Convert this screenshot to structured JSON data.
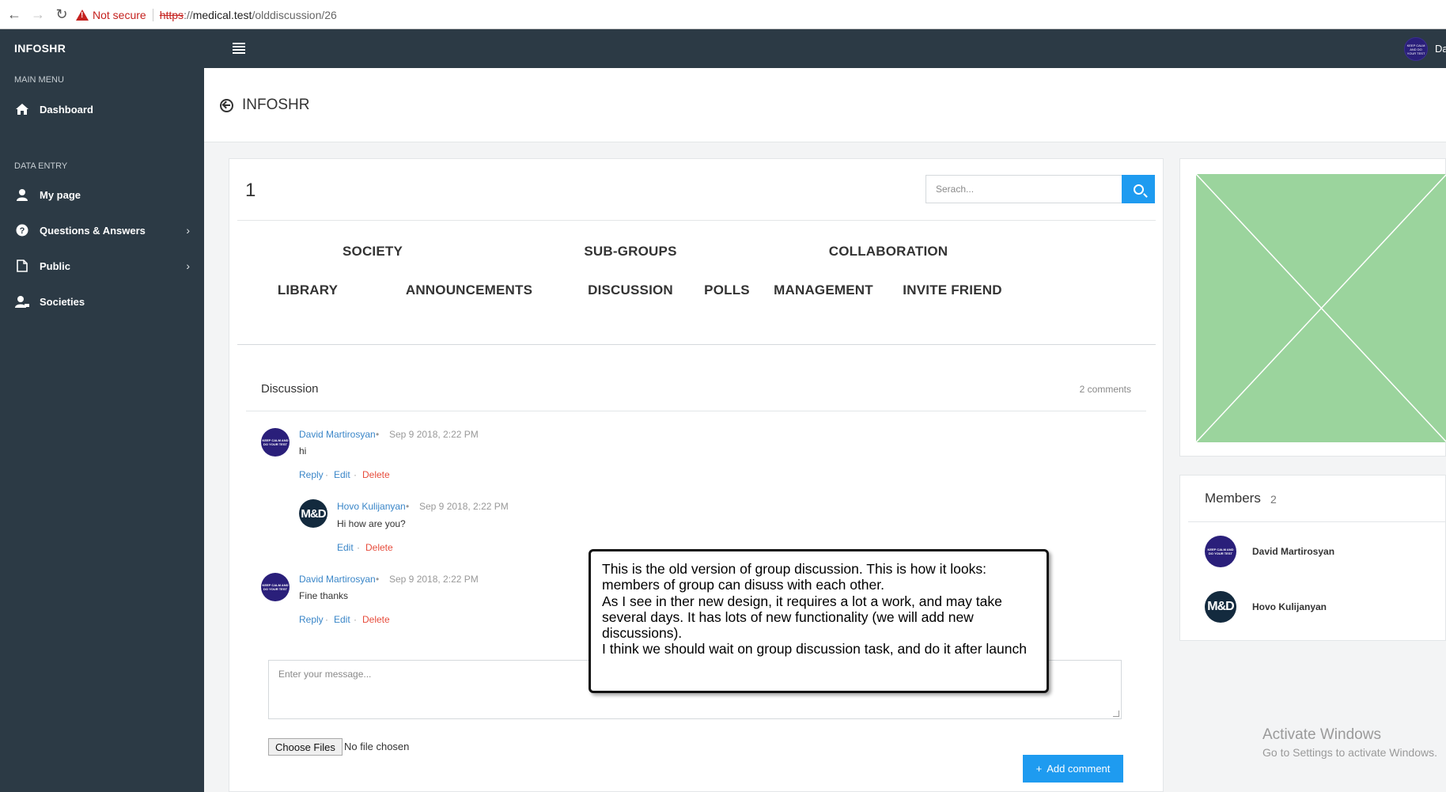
{
  "browser": {
    "security_label": "Not secure",
    "url_scheme": "https",
    "url_sep": "://",
    "url_host": "medical.test",
    "url_path": "/olddiscussion/26"
  },
  "header": {
    "brand": "INFOSHR",
    "user_name_partial": "Da",
    "user_avatar_text": "KEEP CALM AND DO YOUR TEST"
  },
  "sidebar": {
    "sections": [
      {
        "label": "MAIN MENU",
        "items": [
          {
            "label": "Dashboard",
            "icon": "home-icon",
            "has_submenu": false
          }
        ]
      },
      {
        "label": "DATA ENTRY",
        "items": [
          {
            "label": "My page",
            "icon": "user-icon",
            "has_submenu": false
          },
          {
            "label": "Questions & Answers",
            "icon": "question-circle-icon",
            "has_submenu": true
          },
          {
            "label": "Public",
            "icon": "file-icon",
            "has_submenu": true
          },
          {
            "label": "Societies",
            "icon": "user-group-icon",
            "has_submenu": false
          }
        ]
      }
    ]
  },
  "page": {
    "title": "INFOSHR"
  },
  "main": {
    "group_id": "1",
    "search": {
      "placeholder": "Serach...",
      "value": ""
    },
    "tabs_row1": [
      "SOCIETY",
      "SUB-GROUPS",
      "COLLABORATION"
    ],
    "tabs_row2": [
      "LIBRARY",
      "ANNOUNCEMENTS",
      "DISCUSSION",
      "POLLS",
      "MANAGEMENT",
      "INVITE FRIEND"
    ],
    "discussion": {
      "title": "Discussion",
      "count_label": "2 comments",
      "comments": [
        {
          "author": "David Martirosyan",
          "time": "Sep 9 2018, 2:22 PM",
          "text": "hi",
          "actions": [
            "Reply",
            "Edit",
            "Delete"
          ],
          "avatar": "KEEP CALM AND DO YOUR TEST"
        },
        {
          "author": "Hovo Kulijanyan",
          "time": "Sep 9 2018, 2:22 PM",
          "text": "Hi how are you?",
          "actions": [
            "Edit",
            "Delete"
          ],
          "avatar": "M&D",
          "reply": true
        },
        {
          "author": "David Martirosyan",
          "time": "Sep 9 2018, 2:22 PM",
          "text": "Fine thanks",
          "actions": [
            "Reply",
            "Edit",
            "Delete"
          ],
          "avatar": "KEEP CALM AND DO YOUR TEST"
        }
      ],
      "dot": "•",
      "action_dot": "·",
      "message_placeholder": "Enter your message...",
      "choose_files_label": "Choose Files",
      "no_file_label": "No file chosen",
      "add_comment_label": "Add comment"
    }
  },
  "members": {
    "title": "Members",
    "count": "2",
    "list": [
      {
        "name": "David Martirosyan",
        "avatar": "KEEP CALM AND DO YOUR TEST"
      },
      {
        "name": "Hovo Kulijanyan",
        "avatar": "M&D"
      }
    ]
  },
  "annotation": {
    "lines": [
      "This is the old version of group discussion. This is how it looks:",
      "members of group can disuss with each other.",
      "As I see in ther new design, it requires a lot a work, and may take several days. It has lots of new functionality (we will add new discussions).",
      "I think we should wait on group discussion task, and do it after launch"
    ]
  },
  "os_watermark": {
    "line1": "Activate Windows",
    "line2": "Go to Settings to activate Windows."
  },
  "colors": {
    "sidebar_bg": "#2c3a45",
    "accent_blue": "#1e9bf0",
    "link_blue": "#3a86c8",
    "delete_red": "#e74c3c",
    "placeholder_green": "#9bd49d"
  }
}
